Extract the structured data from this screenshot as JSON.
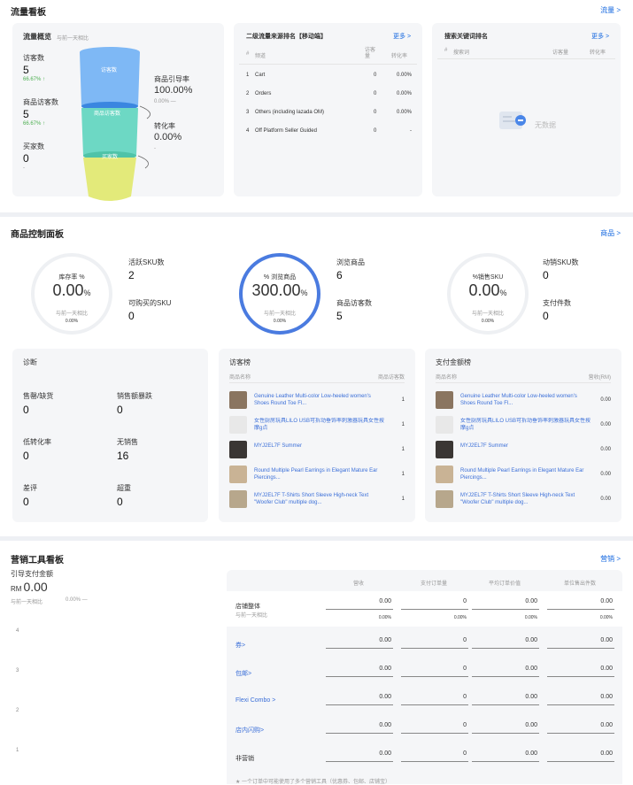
{
  "traffic": {
    "title": "流量看板",
    "more": "流量 >",
    "overview": {
      "title": "流量概览",
      "subtitle": "与前一天相比",
      "visitors_label": "访客数",
      "visitors_value": "5",
      "visitors_change": "66.67% ↑",
      "product_visitors_label": "商品访客数",
      "product_visitors_value": "5",
      "product_visitors_change": "66.67% ↑",
      "buyers_label": "买家数",
      "buyers_value": "0",
      "buyers_change": "-",
      "funnel_top": "访客数",
      "funnel_mid": "商品访客数",
      "funnel_bot": "买家数",
      "guide_rate_label": "商品引导率",
      "guide_rate_value": "100.00%",
      "guide_rate_change": "0.00% —",
      "conv_label": "转化率",
      "conv_value": "0.00%",
      "conv_change": "-"
    },
    "sources": {
      "title": "二级流量来源排名【移动端】",
      "more": "更多 >",
      "col_rank": "#",
      "col_channel": "频道",
      "col_visitors": "访客量",
      "col_conv": "转化率",
      "rows": [
        {
          "rank": "1",
          "channel": "Cart",
          "visitors": "0",
          "conv": "0.00%"
        },
        {
          "rank": "2",
          "channel": "Orders",
          "visitors": "0",
          "conv": "0.00%"
        },
        {
          "rank": "3",
          "channel": "Others (including lazada OM)",
          "visitors": "0",
          "conv": "0.00%"
        },
        {
          "rank": "4",
          "channel": "Off Platform Seller Guided",
          "visitors": "0",
          "conv": "-"
        }
      ]
    },
    "keywords": {
      "title": "搜索关键词排名",
      "more": "更多 >",
      "col_rank": "#",
      "col_kw": "搜索词",
      "col_visitors": "访客量",
      "col_conv": "转化率",
      "empty": "无数据"
    }
  },
  "products": {
    "title": "商品控制面板",
    "more": "商品 >",
    "gauge1": {
      "label": "库存率 %",
      "value": "0.00",
      "unit": "%",
      "sub": "与前一天相比",
      "change": "0.00%",
      "fill": 0
    },
    "gauge2": {
      "label": "% 浏览商品",
      "value": "300.00",
      "unit": "%",
      "sub": "与前一天相比",
      "change": "0.00%",
      "fill": 1
    },
    "gauge3": {
      "label": "%销售SKU",
      "value": "0.00",
      "unit": "%",
      "sub": "与前一天相比",
      "change": "0.00%",
      "fill": 0
    },
    "stat_active_sku_label": "活跃SKU数",
    "stat_active_sku_value": "2",
    "stat_buyable_sku_label": "可购买的SKU",
    "stat_buyable_sku_value": "0",
    "stat_viewed_label": "浏览商品",
    "stat_viewed_value": "6",
    "stat_pv_label": "商品访客数",
    "stat_pv_value": "5",
    "stat_moving_label": "动销SKU数",
    "stat_moving_value": "0",
    "stat_paid_label": "支付件数",
    "stat_paid_value": "0",
    "diag": {
      "title": "诊断",
      "items": [
        {
          "label": "售罄/缺货",
          "value": "0"
        },
        {
          "label": "销售额暴跌",
          "value": "0"
        },
        {
          "label": "低转化率",
          "value": "0"
        },
        {
          "label": "无销售",
          "value": "16"
        },
        {
          "label": "差评",
          "value": "0"
        },
        {
          "label": "超重",
          "value": "0"
        }
      ]
    },
    "visitors_rank": {
      "title": "访客榜",
      "col_name": "商品名称",
      "col_val": "商品访客数",
      "rows": [
        {
          "name": "Genuine Leather Multi-color Low-heeled women's Shoes Round Toe Fl...",
          "val": "1"
        },
        {
          "name": "女性厨房玩具LILO USB可拆动垂饰率刺激器玩具女性按摩g点",
          "val": "1"
        },
        {
          "name": "MYJ2EL7F Summer",
          "val": "1"
        },
        {
          "name": "Round Multiple Pearl Earrings in Elegant Mature Ear Piercings...",
          "val": "1"
        },
        {
          "name": "MYJ2EL7F T-Shirts Short Sleeve High-neck Text \"Woofer Club\" multiple dog...",
          "val": "1"
        }
      ]
    },
    "sales_rank": {
      "title": "支付金额榜",
      "col_name": "商品名称",
      "col_val": "营收(RM)",
      "rows": [
        {
          "name": "Genuine Leather Multi-color Low-heeled women's Shoes Round Toe Fl...",
          "val": "0.00"
        },
        {
          "name": "女性厨房玩具LILO USB可拆动垂饰率刺激器玩具女性按摩g点",
          "val": "0.00"
        },
        {
          "name": "MYJ2EL7F Summer",
          "val": "0.00"
        },
        {
          "name": "Round Multiple Pearl Earrings in Elegant Mature Ear Piercings...",
          "val": "0.00"
        },
        {
          "name": "MYJ2EL7F T-Shirts Short Sleeve High-neck Text \"Woofer Club\" multiple dog...",
          "val": "0.00"
        }
      ]
    }
  },
  "marketing": {
    "title": "营销工具看板",
    "more": "营销 >",
    "guided_label": "引导支付金额",
    "currency": "RM",
    "guided_value": "0.00",
    "compare": "与前一天相比",
    "compare_change": "0.00% —",
    "chart_ticks": [
      "4",
      "3",
      "2",
      "1"
    ],
    "table": {
      "cols": [
        "营收",
        "支付订单量",
        "平均订单价值",
        "单位售出件数"
      ],
      "rows": [
        {
          "name": "店铺整体",
          "sub": "与前一天相比",
          "link": false,
          "vals": [
            "0.00",
            "0",
            "0.00",
            "0.00"
          ],
          "changes": [
            "0.00%",
            "0.00%",
            "0.00%",
            "0.00%"
          ]
        },
        {
          "name": "券>",
          "link": true,
          "vals": [
            "0.00",
            "0",
            "0.00",
            "0.00"
          ]
        },
        {
          "name": "包邮>",
          "link": true,
          "vals": [
            "0.00",
            "0",
            "0.00",
            "0.00"
          ]
        },
        {
          "name": "Flexi Combo >",
          "link": true,
          "vals": [
            "0.00",
            "0",
            "0.00",
            "0.00"
          ]
        },
        {
          "name": "店内闪购>",
          "link": true,
          "vals": [
            "0.00",
            "0",
            "0.00",
            "0.00"
          ]
        },
        {
          "name": "非营销",
          "link": false,
          "vals": [
            "0.00",
            "0",
            "0.00",
            "0.00"
          ]
        }
      ],
      "footnote": "★ 一个订单中可能使用了多个营销工具（优惠券、包邮、店铺宝）"
    }
  },
  "colors": {
    "accent": "#1a6be0",
    "gauge_fill": "#4a7be0"
  }
}
